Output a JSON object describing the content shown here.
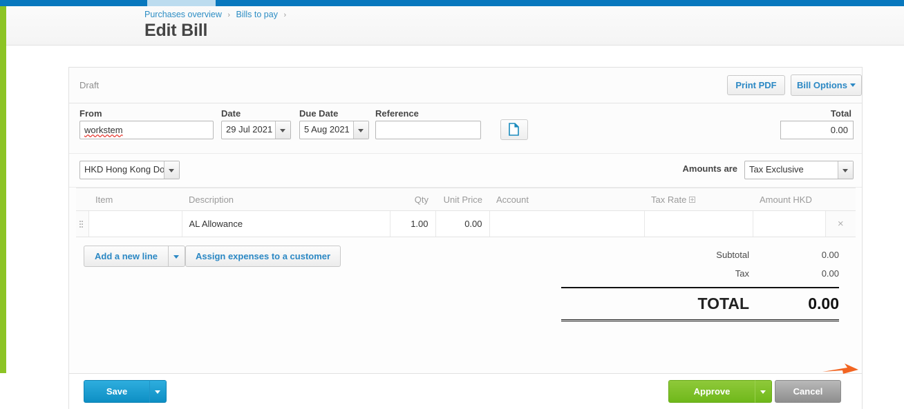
{
  "header": {
    "breadcrumb": [
      {
        "label": "Purchases overview"
      },
      {
        "label": "Bills to pay"
      }
    ],
    "separator": "›",
    "title": "Edit Bill"
  },
  "card": {
    "status": "Draft",
    "print_pdf_label": "Print PDF",
    "bill_options_label": "Bill Options",
    "fields": {
      "from_label": "From",
      "from_value": "workstem",
      "date_label": "Date",
      "date_value": "29 Jul 2021",
      "due_date_label": "Due Date",
      "due_date_value": "5 Aug 2021",
      "reference_label": "Reference",
      "reference_value": "",
      "attach_icon": "document-icon",
      "total_label": "Total",
      "total_value": "0.00"
    },
    "currency": {
      "selected": "HKD Hong Kong Dollar",
      "amounts_are_label": "Amounts are",
      "amounts_are_selected": "Tax Exclusive"
    },
    "table": {
      "columns": [
        {
          "key": "item",
          "label": "Item",
          "align": "left"
        },
        {
          "key": "description",
          "label": "Description",
          "align": "left"
        },
        {
          "key": "qty",
          "label": "Qty",
          "align": "right"
        },
        {
          "key": "unit_price",
          "label": "Unit Price",
          "align": "right"
        },
        {
          "key": "account",
          "label": "Account",
          "align": "left"
        },
        {
          "key": "tax_rate",
          "label": "Tax Rate",
          "align": "left",
          "icon": "expand-box-icon"
        },
        {
          "key": "amount",
          "label": "Amount HKD",
          "align": "left"
        }
      ],
      "rows": [
        {
          "item": "",
          "description": "AL Allowance",
          "qty": "1.00",
          "unit_price": "0.00",
          "account": "",
          "tax_rate": "",
          "amount": "",
          "remove_icon": "×",
          "drag_handle": "drag-handle-icon"
        }
      ]
    },
    "add_line_label": "Add a new line",
    "assign_expenses_label": "Assign expenses to a customer",
    "totals": {
      "subtotal_label": "Subtotal",
      "subtotal_value": "0.00",
      "tax_label": "Tax",
      "tax_value": "0.00",
      "grand_label": "TOTAL",
      "grand_value": "0.00"
    }
  },
  "footer": {
    "save_label": "Save",
    "approve_label": "Approve",
    "cancel_label": "Cancel"
  },
  "colors": {
    "topbar_blue": "#0878be",
    "rail_green": "#8cc425",
    "link_blue": "#2b88c4",
    "approve_green": "#7cc02a",
    "save_blue": "#0d8fc4",
    "cancel_gray": "#9a9a9a",
    "cursor_orange": "#f26522"
  }
}
